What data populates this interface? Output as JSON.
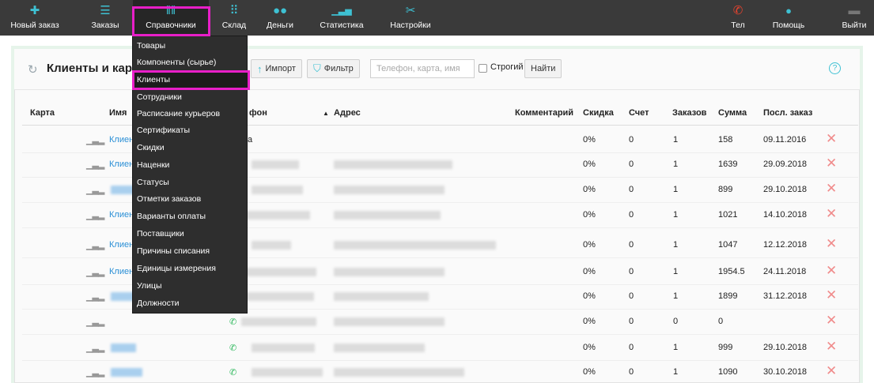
{
  "topnav": {
    "items": [
      {
        "label": "Новый заказ",
        "icon": "plus-icon"
      },
      {
        "label": "Заказы",
        "icon": "list-icon"
      },
      {
        "label": "Справочники",
        "icon": "columns-icon"
      },
      {
        "label": "Склад",
        "icon": "grid-icon"
      },
      {
        "label": "Деньги",
        "icon": "coins-icon"
      },
      {
        "label": "Статистика",
        "icon": "bar-chart-icon"
      },
      {
        "label": "Настройки",
        "icon": "tools-icon"
      },
      {
        "label": "Тел",
        "icon": "phone-icon"
      },
      {
        "label": "Помощь",
        "icon": "help-icon"
      },
      {
        "label": "Выйти",
        "icon": "logout-icon"
      }
    ]
  },
  "menu": {
    "items": [
      "Товары",
      "Компоненты (сырье)",
      "Клиенты",
      "Сотрудники",
      "Расписание курьеров",
      "Сертификаты",
      "Скидки",
      "Наценки",
      "Статусы",
      "Отметки заказов",
      "Варианты оплаты",
      "Поставщики",
      "Причины списания",
      "Единицы измерения",
      "Улицы",
      "Должности"
    ],
    "active": "Клиенты"
  },
  "header": {
    "title": "Клиенты и карт",
    "import_label": "Импорт",
    "filter_label": "Фильтр",
    "search_placeholder": "Телефон, карта, имя",
    "strict_label": "Строгий",
    "find_label": "Найти"
  },
  "table": {
    "columns": [
      "Карта",
      "Имя",
      "фон",
      "Адрес",
      "Комментарий",
      "Скидка",
      "Счет",
      "Заказов",
      "Сумма",
      "Посл. заказ"
    ],
    "rows": [
      {
        "name": "Клиент",
        "phone": "а",
        "discount": "0%",
        "account": "0",
        "orders": "1",
        "sum": "158",
        "last": "09.11.2016"
      },
      {
        "name": "Клиент",
        "phone": "",
        "discount": "0%",
        "account": "0",
        "orders": "1",
        "sum": "1639",
        "last": "29.09.2018"
      },
      {
        "name": "",
        "phone": "",
        "discount": "0%",
        "account": "0",
        "orders": "1",
        "sum": "899",
        "last": "29.10.2018"
      },
      {
        "name": "Клиент",
        "phone": "",
        "discount": "0%",
        "account": "0",
        "orders": "1",
        "sum": "1021",
        "last": "14.10.2018"
      },
      {
        "name": "Клиент",
        "phone": "",
        "discount": "0%",
        "account": "0",
        "orders": "1",
        "sum": "1047",
        "last": "12.12.2018"
      },
      {
        "name": "Клиент",
        "phone": "",
        "discount": "0%",
        "account": "0",
        "orders": "1",
        "sum": "1954.5",
        "last": "24.11.2018"
      },
      {
        "name": "",
        "phone": "",
        "discount": "0%",
        "account": "0",
        "orders": "1",
        "sum": "1899",
        "last": "31.12.2018"
      },
      {
        "name": "",
        "phone": "",
        "discount": "0%",
        "account": "0",
        "orders": "0",
        "sum": "0",
        "last": ""
      },
      {
        "name": "",
        "phone": "",
        "discount": "0%",
        "account": "0",
        "orders": "1",
        "sum": "999",
        "last": "29.10.2018"
      },
      {
        "name": "",
        "phone": "",
        "discount": "0%",
        "account": "0",
        "orders": "1",
        "sum": "1090",
        "last": "30.10.2018"
      }
    ]
  },
  "colors": {
    "topbar": "#3a3a3a",
    "accent": "#3ec1d3",
    "link": "#2a8fd6",
    "highlight": "#e81fc8",
    "delete": "#f08b8b"
  }
}
